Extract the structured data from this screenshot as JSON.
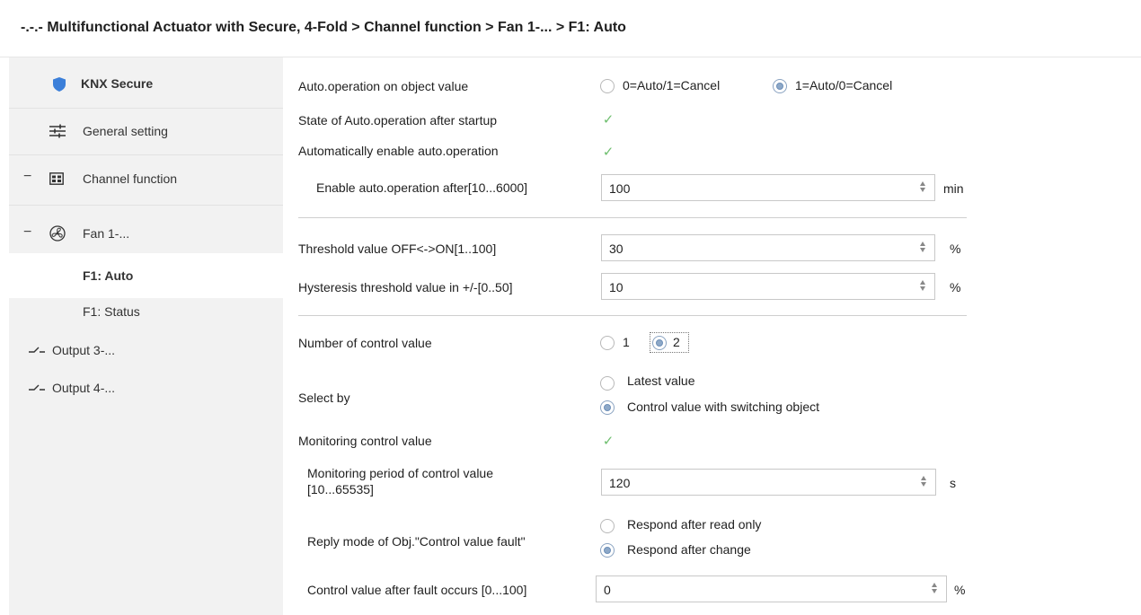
{
  "header": {
    "breadcrumb": "-.-.- Multifunctional Actuator with Secure, 4-Fold > Channel function > Fan 1-... > F1: Auto"
  },
  "sidebar": {
    "items": [
      {
        "label": "KNX Secure",
        "icon": "shield-icon"
      },
      {
        "label": "General setting",
        "icon": "sliders-icon"
      },
      {
        "label": "Channel function",
        "icon": "channel-grid-icon",
        "expander": "−"
      },
      {
        "label": "Fan 1-...",
        "icon": "fan-icon",
        "expander": "−"
      },
      {
        "label": "F1: Auto",
        "selected": true
      },
      {
        "label": "F1: Status"
      },
      {
        "label": "Output 3-...",
        "icon": "switch-icon"
      },
      {
        "label": "Output 4-...",
        "icon": "switch-icon"
      }
    ]
  },
  "form": {
    "auto_op": {
      "label": "Auto.operation on object value",
      "options": [
        "0=Auto/1=Cancel",
        "1=Auto/0=Cancel"
      ],
      "selected": "1=Auto/0=Cancel"
    },
    "state_after_startup": {
      "label": "State of Auto.operation after startup",
      "checked": true
    },
    "auto_enable": {
      "label": "Automatically enable auto.operation",
      "checked": true
    },
    "enable_after": {
      "label": "Enable auto.operation after[10...6000]",
      "value": "100",
      "unit": "min"
    },
    "threshold": {
      "label": "Threshold value OFF<->ON[1..100]",
      "value": "30",
      "unit": "%"
    },
    "hysteresis": {
      "label": "Hysteresis threshold value in +/-[0..50]",
      "value": "10",
      "unit": "%"
    },
    "num_control": {
      "label": "Number of control value",
      "options": [
        "1",
        "2"
      ],
      "selected": "2"
    },
    "select_by": {
      "label": "Select by",
      "options": [
        "Latest value",
        "Control value with switching object"
      ],
      "selected": "Control value with switching object"
    },
    "monitoring": {
      "label": "Monitoring control value",
      "checked": true
    },
    "monitoring_period": {
      "label_line1": "Monitoring period of control value",
      "label_line2": "[10...65535]",
      "value": "120",
      "unit": "s"
    },
    "reply_mode": {
      "label": "Reply mode of Obj.\"Control value fault\"",
      "options": [
        "Respond after read only",
        "Respond after change"
      ],
      "selected": "Respond after change"
    },
    "fault_value": {
      "label": "Control value after fault occurs [0...100]",
      "value": "0",
      "unit": "%"
    }
  },
  "colors": {
    "check": "#6fbf6f",
    "radio_selected": "#8da8c8",
    "sidebar_bg": "#f2f2f2",
    "shield": "#3b7fd9"
  }
}
